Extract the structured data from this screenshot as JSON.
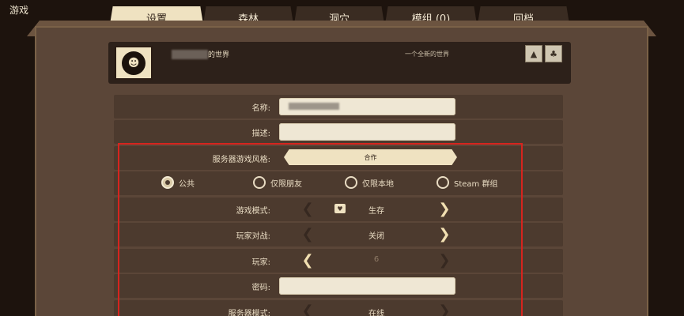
{
  "corner_title": "游戏",
  "tabs": [
    {
      "label": "设置",
      "active": true
    },
    {
      "label": "森林",
      "active": false
    },
    {
      "label": "洞穴",
      "active": false
    },
    {
      "label": "模组 (0)",
      "active": false
    },
    {
      "label": "回档",
      "active": false
    }
  ],
  "world": {
    "name_suffix": "的世界",
    "description": "一个全新的世界",
    "avatar_icon": "character-portrait-icon",
    "icons": [
      "ruins-icon",
      "forest-icon"
    ]
  },
  "form": {
    "name_label": "名称:",
    "name_value": "",
    "description_label": "描述:",
    "description_value": "",
    "server_style_label": "服务器游戏风格:",
    "server_style_value": "合作",
    "privacy_options": [
      {
        "label": "公共",
        "selected": true
      },
      {
        "label": "仅限朋友",
        "selected": false
      },
      {
        "label": "仅限本地",
        "selected": false
      },
      {
        "label": "Steam 群组",
        "selected": false
      }
    ],
    "game_mode_label": "游戏模式:",
    "game_mode_value": "生存",
    "pvp_label": "玩家对战:",
    "pvp_value": "关闭",
    "players_label": "玩家:",
    "players_value": "6",
    "password_label": "密码:",
    "password_value": "",
    "server_mode_label": "服务器模式:",
    "server_mode_value": "在线"
  },
  "colors": {
    "highlight_border": "#d6241e",
    "active_tab": "#efe2c1",
    "panel": "#5b4638"
  }
}
